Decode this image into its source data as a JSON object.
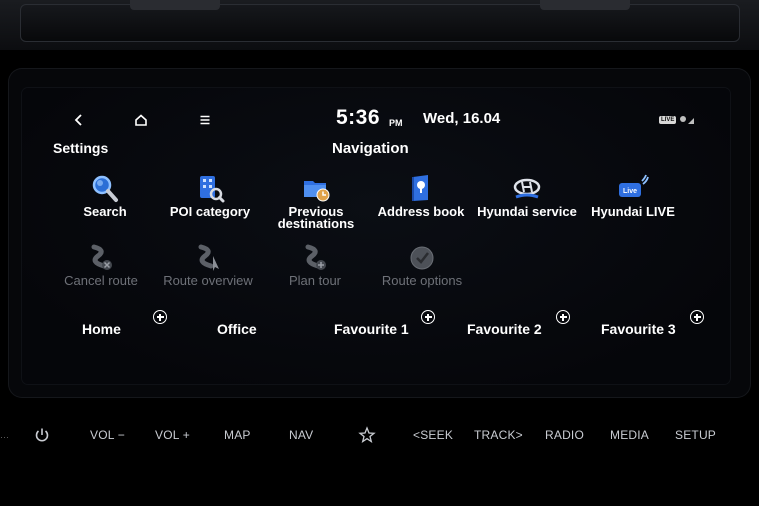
{
  "status_bar": {
    "time": "5:36",
    "ampm": "PM",
    "date": "Wed, 16.04",
    "live_badge": "LIVE"
  },
  "header": {
    "settings_label": "Settings",
    "title": "Navigation"
  },
  "menu": [
    {
      "label": "Search",
      "icon": "search-icon",
      "enabled": true
    },
    {
      "label": "POI category",
      "icon": "poi-category-icon",
      "enabled": true
    },
    {
      "label_line1": "Previous",
      "label_line2": "destinations",
      "icon": "previous-destinations-icon",
      "enabled": true
    },
    {
      "label": "Address book",
      "icon": "address-book-icon",
      "enabled": true
    },
    {
      "label": "Hyundai service",
      "icon": "hyundai-service-icon",
      "enabled": true
    },
    {
      "label": "Hyundai LIVE",
      "icon": "hyundai-live-icon",
      "enabled": true
    },
    {
      "label": "Cancel route",
      "icon": "cancel-route-icon",
      "enabled": false
    },
    {
      "label": "Route overview",
      "icon": "route-overview-icon",
      "enabled": false
    },
    {
      "label": "Plan tour",
      "icon": "plan-tour-icon",
      "enabled": false
    },
    {
      "label": "Route options",
      "icon": "route-options-icon",
      "enabled": false
    }
  ],
  "favourites": [
    {
      "label": "Home"
    },
    {
      "label": "Office"
    },
    {
      "label": "Favourite 1"
    },
    {
      "label": "Favourite 2"
    },
    {
      "label": "Favourite 3"
    }
  ],
  "hard_buttons": {
    "vol_down": "VOL −",
    "vol_up": "VOL +",
    "map": "MAP",
    "nav": "NAV",
    "seek": "SEEK",
    "track": "TRACK",
    "radio": "RADIO",
    "media": "MEDIA",
    "setup": "SETUP"
  },
  "colors": {
    "accent_blue": "#3a8dff",
    "disabled_text": "#6e7178"
  }
}
